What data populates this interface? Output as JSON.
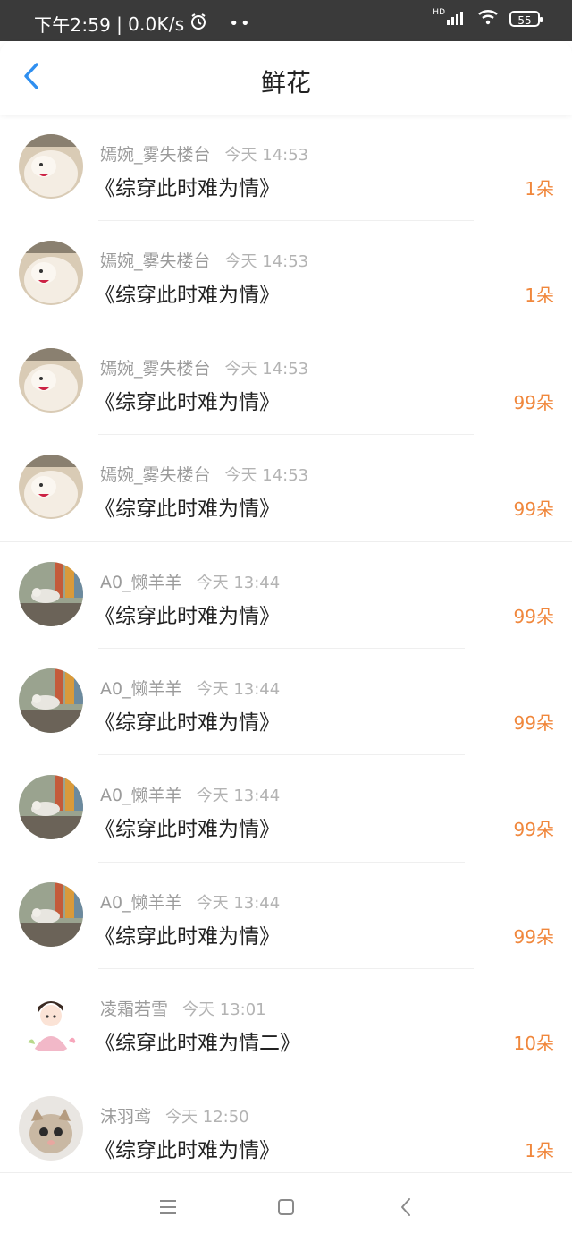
{
  "status_bar": {
    "time": "下午2:59",
    "network_speed": "0.0K/s",
    "dots": "••",
    "battery": "55",
    "hd": "HD"
  },
  "nav": {
    "title": "鲜花"
  },
  "items": [
    {
      "name": "嫣婉_雾失楼台",
      "time": "今天 14:53",
      "book": "《综穿此时难为情》",
      "count": "1朵"
    },
    {
      "name": "嫣婉_雾失楼台",
      "time": "今天 14:53",
      "book": "《综穿此时难为情》",
      "count": "1朵"
    },
    {
      "name": "嫣婉_雾失楼台",
      "time": "今天 14:53",
      "book": "《综穿此时难为情》",
      "count": "99朵"
    },
    {
      "name": "嫣婉_雾失楼台",
      "time": "今天 14:53",
      "book": "《综穿此时难为情》",
      "count": "99朵"
    },
    {
      "name": "A0_懒羊羊",
      "time": "今天 13:44",
      "book": "《综穿此时难为情》",
      "count": "99朵"
    },
    {
      "name": "A0_懒羊羊",
      "time": "今天 13:44",
      "book": "《综穿此时难为情》",
      "count": "99朵"
    },
    {
      "name": "A0_懒羊羊",
      "time": "今天 13:44",
      "book": "《综穿此时难为情》",
      "count": "99朵"
    },
    {
      "name": "A0_懒羊羊",
      "time": "今天 13:44",
      "book": "《综穿此时难为情》",
      "count": "99朵"
    },
    {
      "name": "凌霜若雪",
      "time": "今天 13:01",
      "book": "《综穿此时难为情二》",
      "count": "10朵"
    },
    {
      "name": "沫羽鸢",
      "time": "今天 12:50",
      "book": "《综穿此时难为情》",
      "count": "1朵"
    }
  ],
  "colors": {
    "accent_blue": "#2f8ff0",
    "count_orange": "#f0873c",
    "status_bar_bg": "#3a3a3a"
  },
  "icons": {
    "back": "chevron-left-icon",
    "menu": "menu-icon",
    "home": "square-home-icon",
    "nav_back": "triangle-back-icon"
  }
}
